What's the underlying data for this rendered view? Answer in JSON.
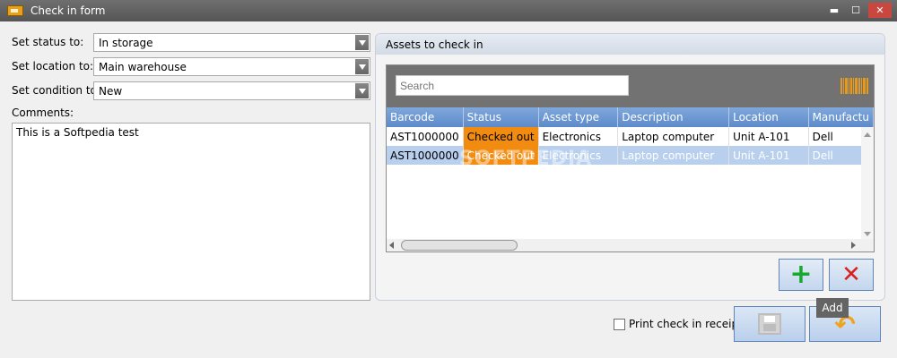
{
  "window": {
    "title": "Check in form",
    "controls": {
      "minimize": "▬",
      "maximize": "☐",
      "close": "✕"
    }
  },
  "form": {
    "status_label": "Set status to:",
    "status_value": "In storage",
    "location_label": "Set location to:",
    "location_value": "Main warehouse",
    "condition_label": "Set condition to:",
    "condition_value": "New",
    "comments_label": "Comments:",
    "comments_value": "This is a Softpedia test"
  },
  "assets": {
    "group_title": "Assets to check in",
    "search_placeholder": "Search",
    "columns": [
      "Barcode",
      "Status",
      "Asset type",
      "Description",
      "Location",
      "Manufactu"
    ],
    "rows": [
      [
        "AST1000000",
        "Checked out",
        "Electronics",
        "Laptop computer",
        "Unit A-101",
        "Dell"
      ],
      [
        "AST1000000",
        "Checked out",
        "Electronics",
        "Laptop computer",
        "Unit A-101",
        "Dell"
      ]
    ],
    "watermark": "SOFTPEDIA"
  },
  "actions": {
    "add_tooltip": "Add",
    "print_receipt_label": "Print check in receipt"
  },
  "colors": {
    "status_checked_out": "#f28c11",
    "header_blue": "#6b98d3",
    "selected_row": "#b8cfee"
  },
  "icons": {
    "add": "plus-icon",
    "remove": "cross-icon",
    "save": "floppy-disk-icon",
    "undo": "undo-arrow-icon",
    "barcode": "barcode-icon"
  }
}
